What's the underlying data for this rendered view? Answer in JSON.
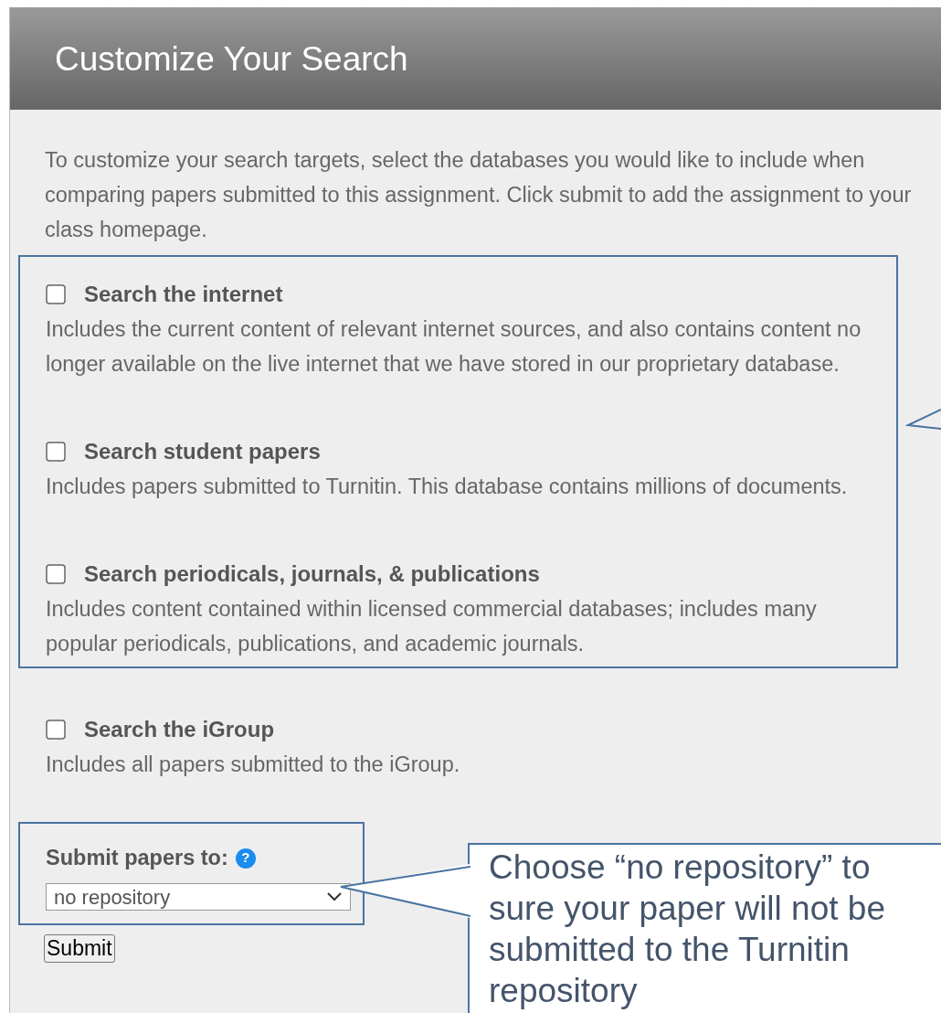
{
  "header": {
    "title": "Customize Your Search"
  },
  "intro": "To customize your search targets, select the databases you would like to include when comparing papers submitted to this assignment. Click submit to add the assignment to your class homepage.",
  "option_groups": [
    {
      "highlighted": true,
      "options": [
        {
          "title": "Search the internet",
          "description": "Includes the current content of relevant internet sources, and also contains content no longer available on the live internet that we have stored in our proprietary database.",
          "checked": false
        },
        {
          "title": "Search student papers",
          "description": "Includes papers submitted to Turnitin. This database contains millions of documents.",
          "checked": false
        },
        {
          "title": "Search periodicals, journals, & publications",
          "description": "Includes content contained within licensed commercial databases; includes many popular periodicals, publications, and academic journals.",
          "checked": false
        }
      ]
    },
    {
      "highlighted": false,
      "options": [
        {
          "title": "Search the iGroup",
          "description": "Includes all papers submitted to the iGroup.",
          "checked": false
        }
      ]
    }
  ],
  "submit_section": {
    "highlighted": true,
    "label": "Submit papers to:",
    "help_icon": "?",
    "select_value": "no repository",
    "button": "Submit"
  },
  "callouts": [
    {
      "kind": "pointer_only"
    },
    {
      "kind": "text",
      "lines": [
        "Choose “no repository” to",
        "sure your paper will not be",
        "submitted to the Turnitin",
        "repository"
      ]
    }
  ]
}
